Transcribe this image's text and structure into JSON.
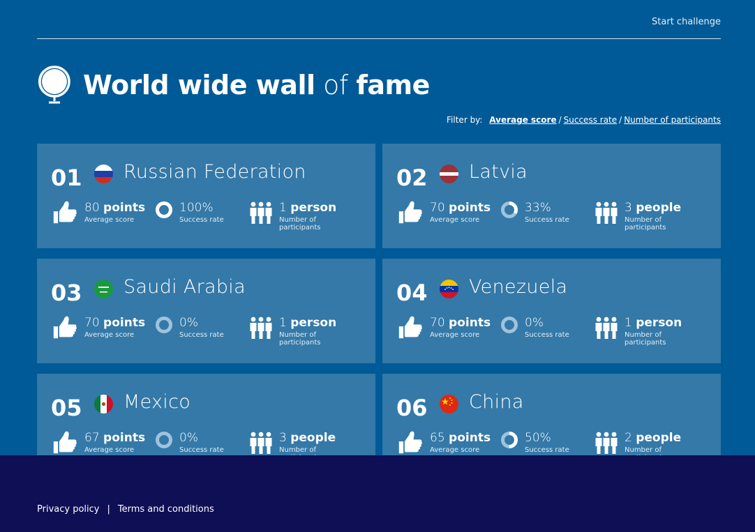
{
  "header": {
    "start_label": "Start challenge"
  },
  "hero": {
    "title_bold1": "World wide wall",
    "title_light": "of",
    "title_bold2": "fame"
  },
  "filter": {
    "label": "Filter by:",
    "options": [
      "Average score",
      "Success rate",
      "Number of participants"
    ],
    "active": "Average score",
    "separator": "/"
  },
  "cards": [
    {
      "rank": "01",
      "country": "Russian Federation",
      "flag": "flag-russia",
      "score": "80",
      "score_unit": "points",
      "score_caption": "Average score",
      "success": "100%",
      "success_fraction": 1.0,
      "success_caption": "Success rate",
      "participants": "1",
      "participants_unit": "person",
      "participants_caption": "Number of participants"
    },
    {
      "rank": "02",
      "country": "Latvia",
      "flag": "flag-latvia",
      "score": "70",
      "score_unit": "points",
      "score_caption": "Average score",
      "success": "33%",
      "success_fraction": 0.33,
      "success_caption": "Success rate",
      "participants": "3",
      "participants_unit": "people",
      "participants_caption": "Number of participants"
    },
    {
      "rank": "03",
      "country": "Saudi Arabia",
      "flag": "flag-saudi-arabia",
      "score": "70",
      "score_unit": "points",
      "score_caption": "Average score",
      "success": "0%",
      "success_fraction": 0,
      "success_caption": "Success rate",
      "participants": "1",
      "participants_unit": "person",
      "participants_caption": "Number of participants"
    },
    {
      "rank": "04",
      "country": "Venezuela",
      "flag": "flag-venezuela",
      "score": "70",
      "score_unit": "points",
      "score_caption": "Average score",
      "success": "0%",
      "success_fraction": 0,
      "success_caption": "Success rate",
      "participants": "1",
      "participants_unit": "person",
      "participants_caption": "Number of participants"
    },
    {
      "rank": "05",
      "country": "Mexico",
      "flag": "flag-mexico",
      "score": "67",
      "score_unit": "points",
      "score_caption": "Average score",
      "success": "0%",
      "success_fraction": 0,
      "success_caption": "Success rate",
      "participants": "3",
      "participants_unit": "people",
      "participants_caption": "Number of participants"
    },
    {
      "rank": "06",
      "country": "China",
      "flag": "flag-china",
      "score": "65",
      "score_unit": "points",
      "score_caption": "Average score",
      "success": "50%",
      "success_fraction": 0.5,
      "success_caption": "Success rate",
      "participants": "2",
      "participants_unit": "people",
      "participants_caption": "Number of participants"
    }
  ],
  "footer": {
    "privacy": "Privacy policy",
    "terms": "Terms and conditions",
    "divider": "|"
  },
  "colors": {
    "background": "#005a97",
    "card": "#3479a8",
    "footer": "#0f0f55",
    "ring_track": "#9fc3dc"
  }
}
